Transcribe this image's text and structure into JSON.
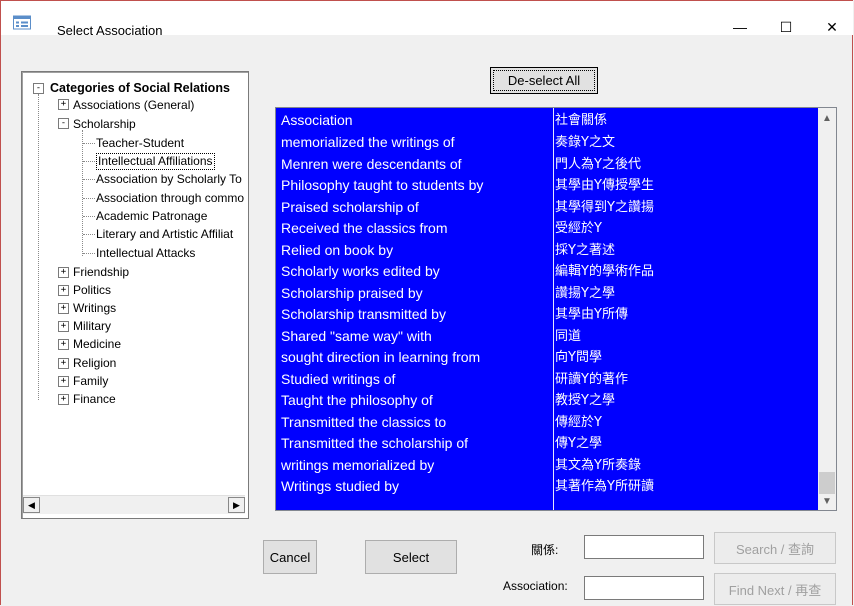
{
  "window": {
    "title": "Select Association",
    "minimize_glyph": "—",
    "maximize_glyph": "☐",
    "close_glyph": "✕"
  },
  "tree": {
    "root": {
      "label": "Categories of Social Relations",
      "expander": "-"
    },
    "nodes": [
      {
        "label": "Associations (General)",
        "expander": "+"
      },
      {
        "label": "Scholarship",
        "expander": "-"
      },
      {
        "label": "Teacher-Student"
      },
      {
        "label": "Intellectual Affiliations"
      },
      {
        "label": "Association by Scholarly To"
      },
      {
        "label": "Association through commo"
      },
      {
        "label": "Academic Patronage"
      },
      {
        "label": "Literary and Artistic Affiliat"
      },
      {
        "label": "Intellectual Attacks"
      },
      {
        "label": "Friendship",
        "expander": "+"
      },
      {
        "label": "Politics",
        "expander": "+"
      },
      {
        "label": "Writings",
        "expander": "+"
      },
      {
        "label": "Military",
        "expander": "+"
      },
      {
        "label": "Medicine",
        "expander": "+"
      },
      {
        "label": "Religion",
        "expander": "+"
      },
      {
        "label": "Family",
        "expander": "+"
      },
      {
        "label": "Finance",
        "expander": "+"
      }
    ],
    "scroll_left": "◀",
    "scroll_right": "▶"
  },
  "deselect_button": "De-select All",
  "list": {
    "header": {
      "col1": "Association",
      "col2": "社會關係"
    },
    "rows": [
      {
        "en": "memorialized the writings of",
        "zh": "奏錄Y之文"
      },
      {
        "en": "Menren were descendants of",
        "zh": "門人為Y之後代"
      },
      {
        "en": "Philosophy taught to students by",
        "zh": "其學由Y傳授學生"
      },
      {
        "en": "Praised scholarship of",
        "zh": "其學得到Y之讚揚"
      },
      {
        "en": "Received the classics from",
        "zh": "受經於Y"
      },
      {
        "en": "Relied on book by",
        "zh": "採Y之著述"
      },
      {
        "en": "Scholarly works edited by",
        "zh": "編輯Y的學術作品"
      },
      {
        "en": "Scholarship praised by",
        "zh": "讚揚Y之學"
      },
      {
        "en": "Scholarship transmitted by",
        "zh": "其學由Y所傳"
      },
      {
        "en": "Shared \"same way\" with",
        "zh": "同道"
      },
      {
        "en": "sought direction in learning from",
        "zh": "向Y問學"
      },
      {
        "en": "Studied writings of",
        "zh": "研讀Y的著作"
      },
      {
        "en": "Taught the philosophy of",
        "zh": "教授Y之學"
      },
      {
        "en": "Transmitted the classics to",
        "zh": "傳經於Y"
      },
      {
        "en": "Transmitted the scholarship of",
        "zh": "傳Y之學"
      },
      {
        "en": "writings memorialized by",
        "zh": "其文為Y所奏錄"
      },
      {
        "en": "Writings studied by",
        "zh": "其著作為Y所研讀"
      }
    ],
    "scroll_up": "▲",
    "scroll_down": "▼"
  },
  "buttons": {
    "cancel": "Cancel",
    "select": "Select",
    "search": "Search / 查詢",
    "find_next": "Find Next / 再查"
  },
  "search": {
    "guanxi_label": "關係:",
    "guanxi_value": "",
    "association_label": "Association:",
    "association_value": ""
  }
}
